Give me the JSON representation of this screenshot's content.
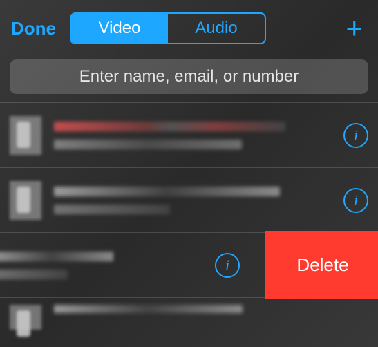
{
  "header": {
    "done_label": "Done",
    "tabs": {
      "video": "Video",
      "audio": "Audio"
    },
    "plus_label": "+"
  },
  "search": {
    "placeholder": "Enter name, email, or number"
  },
  "info_glyph": "i",
  "delete_label": "Delete"
}
